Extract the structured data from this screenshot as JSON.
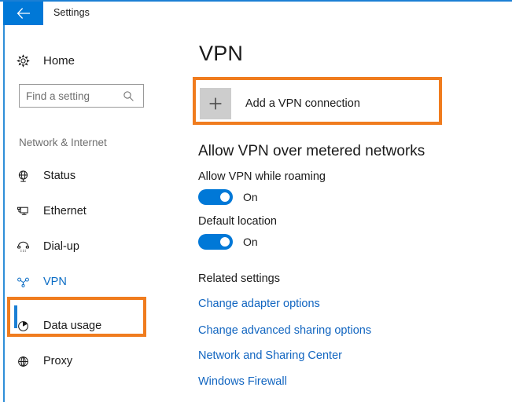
{
  "window": {
    "title": "Settings",
    "back_icon": "back-arrow-icon",
    "accent_color": "#0078d7",
    "highlight_color": "#f07c1e"
  },
  "sidebar": {
    "home": {
      "label": "Home",
      "icon": "gear-icon"
    },
    "search": {
      "placeholder": "Find a setting",
      "value": "",
      "icon": "search-icon"
    },
    "section_header": "Network & Internet",
    "items": [
      {
        "label": "Status",
        "icon": "globe-icon",
        "selected": false
      },
      {
        "label": "Ethernet",
        "icon": "monitor-icon",
        "selected": false
      },
      {
        "label": "Dial-up",
        "icon": "phone-icon",
        "selected": false
      },
      {
        "label": "VPN",
        "icon": "vpn-key-icon",
        "selected": true
      },
      {
        "label": "Data usage",
        "icon": "pie-chart-icon",
        "selected": false
      },
      {
        "label": "Proxy",
        "icon": "globe-icon",
        "selected": false
      }
    ]
  },
  "main": {
    "page_title": "VPN",
    "add_connection": {
      "label": "Add a VPN connection",
      "icon": "plus-icon"
    },
    "metered_heading": "Allow VPN over metered networks",
    "settings": [
      {
        "label": "Allow VPN while roaming",
        "state": "On",
        "enabled": true
      },
      {
        "label": "Default location",
        "state": "On",
        "enabled": true
      }
    ],
    "related_heading": "Related settings",
    "related_links": [
      "Change adapter options",
      "Change advanced sharing options",
      "Network and Sharing Center",
      "Windows Firewall"
    ]
  }
}
